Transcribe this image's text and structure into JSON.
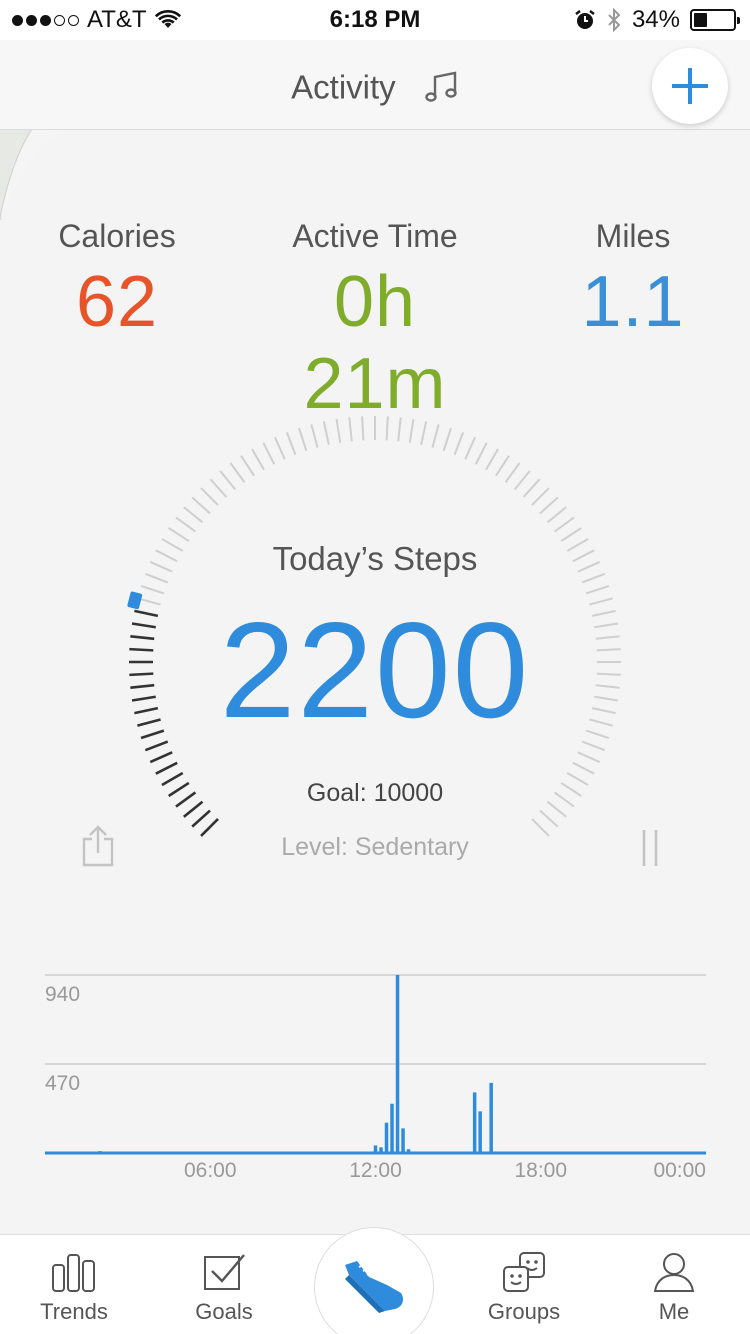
{
  "status_bar": {
    "carrier": "AT&T",
    "time": "6:18 PM",
    "battery_text": "34%",
    "battery_level": 0.34,
    "signal_bars_on": 3,
    "signal_bars_total": 5
  },
  "header": {
    "title": "Activity",
    "music_icon": "music-note-icon",
    "add_icon": "plus-icon"
  },
  "stats": {
    "calories": {
      "label": "Calories",
      "value": "62",
      "color": "#e8542a"
    },
    "active_time": {
      "label": "Active Time",
      "value": "0h 21m",
      "color": "#7fac2b"
    },
    "miles": {
      "label": "Miles",
      "value": "1.1",
      "color": "#3b8fd9"
    }
  },
  "steps": {
    "title": "Today’s Steps",
    "value": "2200",
    "goal_text": "Goal: 10000",
    "level_text": "Level: Sedentary",
    "progress": 0.22,
    "accent": "#2f8bdb"
  },
  "chart_data": {
    "type": "bar",
    "x_ticks": [
      "06:00",
      "12:00",
      "18:00",
      "00:00"
    ],
    "y_ticks": [
      "940",
      "470"
    ],
    "ylim": [
      0,
      940
    ],
    "x_range_hours": [
      0,
      24
    ],
    "series": [
      {
        "color": "#2f8bdb",
        "points": [
          {
            "hour": 2.0,
            "value": 10
          },
          {
            "hour": 10.7,
            "value": 8
          },
          {
            "hour": 12.0,
            "value": 40
          },
          {
            "hour": 12.2,
            "value": 30
          },
          {
            "hour": 12.4,
            "value": 160
          },
          {
            "hour": 12.6,
            "value": 260
          },
          {
            "hour": 12.8,
            "value": 940
          },
          {
            "hour": 13.0,
            "value": 130
          },
          {
            "hour": 13.2,
            "value": 20
          },
          {
            "hour": 15.6,
            "value": 320
          },
          {
            "hour": 15.8,
            "value": 220
          },
          {
            "hour": 16.2,
            "value": 370
          },
          {
            "hour": 18.2,
            "value": 8
          }
        ]
      }
    ]
  },
  "tabbar": {
    "tabs": [
      {
        "label": "Trends",
        "icon": "bar-chart-icon"
      },
      {
        "label": "Goals",
        "icon": "checkbox-icon"
      },
      {
        "label": "",
        "icon": "sneaker-icon"
      },
      {
        "label": "Groups",
        "icon": "groups-icon"
      },
      {
        "label": "Me",
        "icon": "person-icon"
      }
    ]
  }
}
